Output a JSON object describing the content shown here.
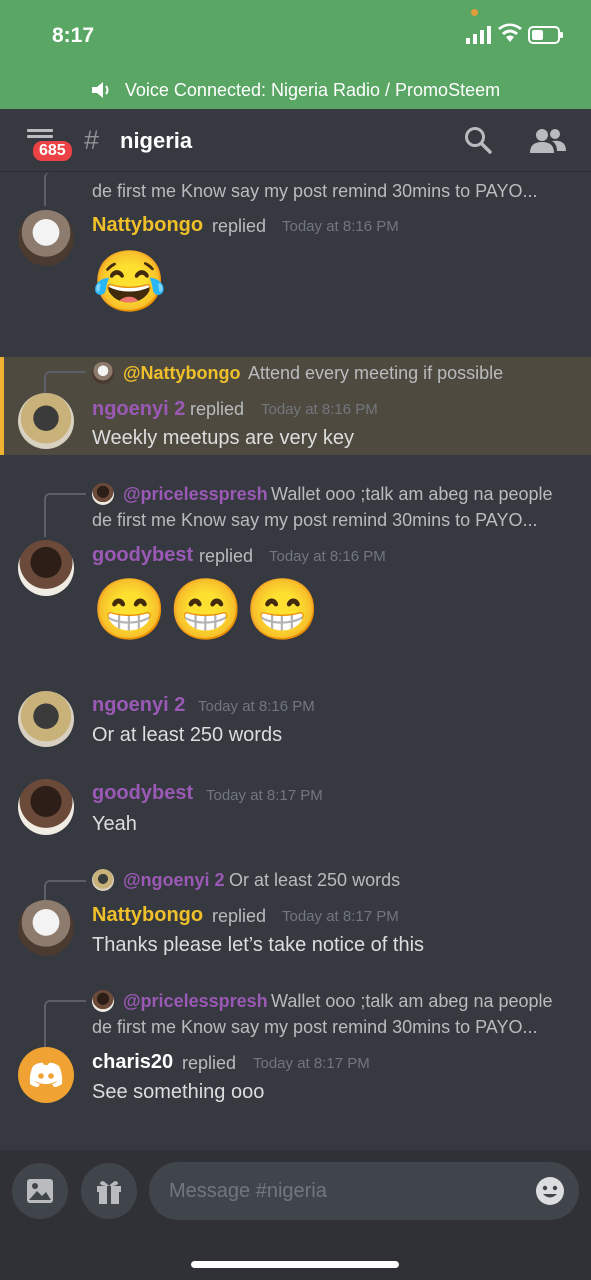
{
  "status_bar": {
    "time": "8:17"
  },
  "voice": {
    "text": "Voice Connected: Nigeria Radio / PromoSteem"
  },
  "header": {
    "badge": "685",
    "hash": "#",
    "channel": "nigeria"
  },
  "messages": [
    {
      "reply_cut_line": "de first me Know say my post remind 30mins to PAYO...",
      "author": "Nattybongo",
      "replied": "replied",
      "time": "Today at 8:16 PM",
      "emoji": "😂"
    },
    {
      "reply_mention": "@Nattybongo",
      "reply_text": "Attend every meeting if possible",
      "author": "ngoenyi 2",
      "replied": "replied",
      "time": "Today at 8:16 PM",
      "text": "Weekly meetups are very key"
    },
    {
      "reply_mention": "@pricelesspresh",
      "reply_text": "Wallet ooo ;talk am abeg na people",
      "reply_line2": "de first me Know say my post remind 30mins to PAYO...",
      "author": "goodybest",
      "replied": "replied",
      "time": "Today at 8:16 PM",
      "emoji": "😁😁😁"
    },
    {
      "author": "ngoenyi 2",
      "time": "Today at 8:16 PM",
      "text": "Or at least 250 words"
    },
    {
      "author": "goodybest",
      "time": "Today at 8:17 PM",
      "text": "Yeah"
    },
    {
      "reply_mention": "@ngoenyi 2",
      "reply_text": "Or at least 250 words",
      "author": "Nattybongo",
      "replied": "replied",
      "time": "Today at 8:17 PM",
      "text": "Thanks please let’s take notice of this"
    },
    {
      "reply_mention": "@pricelesspresh",
      "reply_text": "Wallet ooo ;talk am abeg na people",
      "reply_line2": "de first me Know say my post remind 30mins to PAYO...",
      "author": "charis20",
      "replied": "replied",
      "time": "Today at 8:17 PM",
      "text": "See something ooo"
    }
  ],
  "composer": {
    "placeholder": "Message #nigeria"
  },
  "colors": {
    "accent_green": "#5aa665",
    "mention_gold": "#f0c02a",
    "username_purple": "#9b59b6",
    "badge_red": "#ed4245"
  }
}
